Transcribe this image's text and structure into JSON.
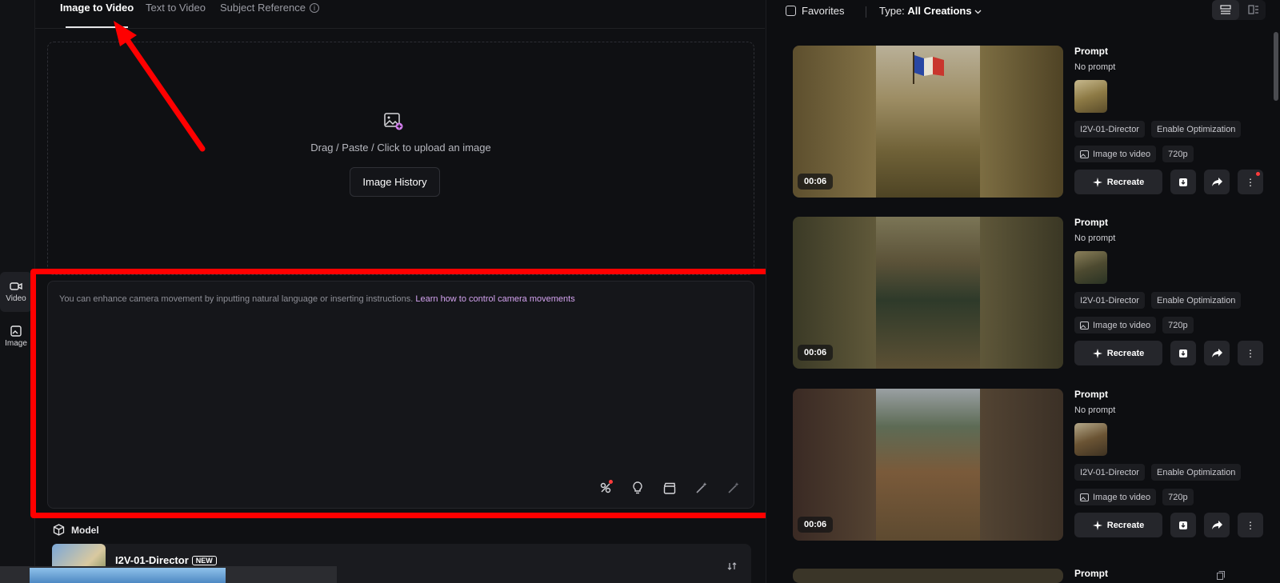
{
  "tabs": [
    {
      "label": "Image to Video",
      "active": true
    },
    {
      "label": "Text to Video",
      "active": false
    },
    {
      "label": "Subject Reference",
      "active": false
    }
  ],
  "rail": {
    "video_label": "Video",
    "image_label": "Image"
  },
  "upload": {
    "instruction": "Drag / Paste / Click to upload an image",
    "history_button": "Image History"
  },
  "prompt": {
    "placeholder": "You can enhance camera movement by inputting natural language or inserting instructions.",
    "link_text": "Learn how to control camera movements",
    "tools": [
      "camera-control-icon",
      "lightbulb-icon",
      "clapperboard-icon",
      "magic-wand-icon",
      "magic-wand-disabled-icon"
    ]
  },
  "model": {
    "section_label": "Model",
    "name": "I2V-01-Director",
    "badge": "NEW",
    "subtitle_fragment": "tor"
  },
  "right_panel": {
    "favorites_label": "Favorites",
    "type_label": "Type:",
    "type_value": "All Creations",
    "cards": [
      {
        "duration": "00:06",
        "prompt_title": "Prompt",
        "prompt_text": "No prompt",
        "model_chip": "I2V-01-Director",
        "opt_chip": "Enable Optimization",
        "mode_chip": "Image to video",
        "res_chip": "720p",
        "recreate_label": "Recreate"
      },
      {
        "duration": "00:06",
        "prompt_title": "Prompt",
        "prompt_text": "No prompt",
        "model_chip": "I2V-01-Director",
        "opt_chip": "Enable Optimization",
        "mode_chip": "Image to video",
        "res_chip": "720p",
        "recreate_label": "Recreate"
      },
      {
        "duration": "00:06",
        "prompt_title": "Prompt",
        "prompt_text": "No prompt",
        "model_chip": "I2V-01-Director",
        "opt_chip": "Enable Optimization",
        "mode_chip": "Image to video",
        "res_chip": "720p",
        "recreate_label": "Recreate"
      },
      {
        "prompt_title": "Prompt"
      }
    ]
  },
  "colors": {
    "accent_link": "#d4a3f0",
    "annotation_red": "#ff0000",
    "background": "#0f1013"
  }
}
